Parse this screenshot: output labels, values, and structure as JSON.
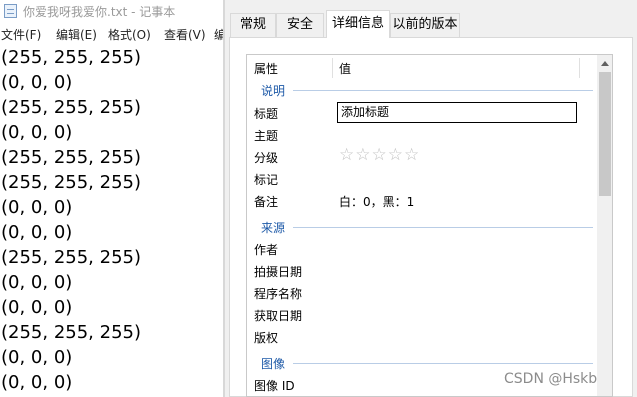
{
  "notepad": {
    "title": "你爱我呀我爱你.txt - 记事本",
    "menu": [
      "文件(F)",
      "编辑(E)",
      "格式(O)",
      "查看(V)",
      "编"
    ],
    "lines": [
      "(255, 255, 255)",
      "(0, 0, 0)",
      "(255, 255, 255)",
      "(0, 0, 0)",
      "(255, 255, 255)",
      "(255, 255, 255)",
      "(0, 0, 0)",
      "(0, 0, 0)",
      "(255, 255, 255)",
      "(0, 0, 0)",
      "(0, 0, 0)",
      "(255, 255, 255)",
      "(0, 0, 0)",
      "(0, 0, 0)"
    ]
  },
  "properties": {
    "tabs": [
      "常规",
      "安全",
      "详细信息",
      "以前的版本"
    ],
    "active_tab": "详细信息",
    "header": {
      "property": "属性",
      "value": "值"
    },
    "sections": {
      "description": "说明",
      "origin": "来源",
      "image": "图像"
    },
    "rows": {
      "title_label": "标题",
      "title_value": "添加标题",
      "subject_label": "主题",
      "rating_label": "分级",
      "rating_stars": "☆☆☆☆☆",
      "tags_label": "标记",
      "comments_label": "备注",
      "comments_value": "白：0，黑：1",
      "author_label": "作者",
      "date_taken_label": "拍摄日期",
      "program_label": "程序名称",
      "date_acquired_label": "获取日期",
      "copyright_label": "版权",
      "image_id_label": "图像 ID"
    }
  },
  "watermark": "CSDN @Hskb"
}
